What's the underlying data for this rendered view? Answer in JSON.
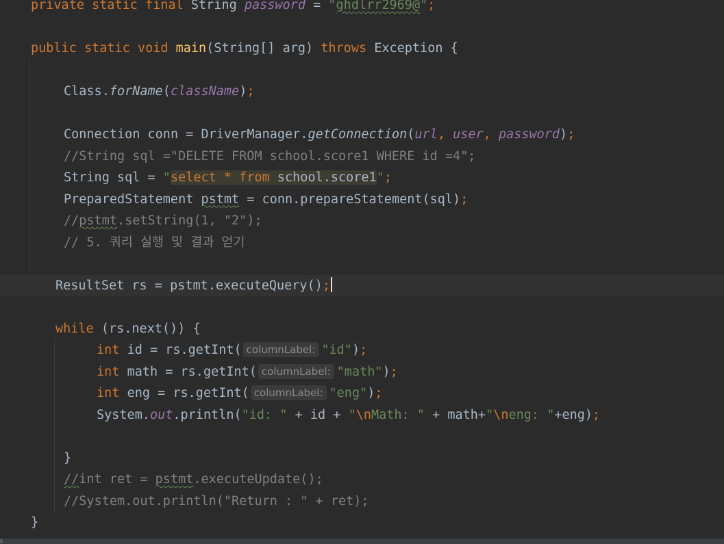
{
  "editor": {
    "language": "java",
    "current_line": 13,
    "lines": [
      {
        "indent": 45,
        "tokens": [
          {
            "t": "private static final ",
            "c": "kw"
          },
          {
            "t": "String ",
            "c": "txt"
          },
          {
            "t": "password",
            "c": "fld"
          },
          {
            "t": " = ",
            "c": "txt"
          },
          {
            "t": "\"",
            "c": "str"
          },
          {
            "t": "ghdlrr2969@",
            "c": "str",
            "w": true
          },
          {
            "t": "\"",
            "c": "str"
          },
          {
            "t": ";",
            "c": "kw"
          }
        ]
      },
      {
        "indent": 45,
        "tokens": []
      },
      {
        "indent": 45,
        "tokens": [
          {
            "t": "public static void ",
            "c": "kw"
          },
          {
            "t": "main",
            "c": "fn"
          },
          {
            "t": "(String[] arg) ",
            "c": "txt"
          },
          {
            "t": "throws ",
            "c": "kw"
          },
          {
            "t": "Exception {",
            "c": "txt"
          }
        ]
      },
      {
        "indent": 93,
        "tokens": []
      },
      {
        "indent": 93,
        "tokens": [
          {
            "t": "Class.",
            "c": "txt"
          },
          {
            "t": "forName",
            "c": "ital"
          },
          {
            "t": "(",
            "c": "txt"
          },
          {
            "t": "className",
            "c": "sfld"
          },
          {
            "t": ")",
            "c": "txt"
          },
          {
            "t": ";",
            "c": "kw"
          }
        ]
      },
      {
        "indent": 93,
        "tokens": []
      },
      {
        "indent": 93,
        "tokens": [
          {
            "t": "Connection ",
            "c": "txt"
          },
          {
            "t": "conn",
            "c": "txt"
          },
          {
            "t": " = DriverManager.",
            "c": "txt"
          },
          {
            "t": "getConnection",
            "c": "ital"
          },
          {
            "t": "(",
            "c": "txt"
          },
          {
            "t": "url",
            "c": "sfld"
          },
          {
            "t": ", ",
            "c": "kw"
          },
          {
            "t": "user",
            "c": "sfld"
          },
          {
            "t": ", ",
            "c": "kw"
          },
          {
            "t": "password",
            "c": "sfld"
          },
          {
            "t": ")",
            "c": "txt"
          },
          {
            "t": ";",
            "c": "kw"
          }
        ]
      },
      {
        "indent": 93,
        "tokens": [
          {
            "t": "//String sql =\"DELETE FROM school.score1 WHERE id =4\";",
            "c": "cmt"
          }
        ]
      },
      {
        "indent": 93,
        "tokens": [
          {
            "t": "String sql = ",
            "c": "txt"
          },
          {
            "t": "\"",
            "c": "str"
          },
          {
            "t": "select",
            "c": "sqlkw",
            "inj": true
          },
          {
            "t": " ",
            "c": "txt",
            "inj": true
          },
          {
            "t": "*",
            "c": "sqlkw",
            "inj": true
          },
          {
            "t": " ",
            "c": "txt",
            "inj": true
          },
          {
            "t": "from",
            "c": "sqlkw",
            "inj": true
          },
          {
            "t": " school.score1",
            "c": "txt",
            "inj": true
          },
          {
            "t": "\"",
            "c": "str"
          },
          {
            "t": ";",
            "c": "kw"
          }
        ]
      },
      {
        "indent": 93,
        "tokens": [
          {
            "t": "PreparedStatement ",
            "c": "txt"
          },
          {
            "t": "pstmt",
            "c": "txt",
            "w": true
          },
          {
            "t": " = conn.prepareStatement(sql)",
            "c": "txt"
          },
          {
            "t": ";",
            "c": "kw"
          }
        ]
      },
      {
        "indent": 93,
        "tokens": [
          {
            "t": "//",
            "c": "cmt"
          },
          {
            "t": "pstmt",
            "c": "cmt",
            "w": true
          },
          {
            "t": ".setString(1, \"2\");",
            "c": "cmt"
          }
        ]
      },
      {
        "indent": 93,
        "tokens": [
          {
            "t": "// 5. 쿼리 실행 및 결과 얻기",
            "c": "cmt"
          }
        ]
      },
      {
        "indent": 81,
        "tokens": []
      },
      {
        "indent": 81,
        "tokens": [
          {
            "t": "ResultSet rs = pstmt.executeQuery()",
            "c": "txt"
          },
          {
            "t": ";",
            "c": "kw"
          },
          {
            "caret": true
          }
        ]
      },
      {
        "indent": 81,
        "tokens": []
      },
      {
        "indent": 81,
        "tokens": [
          {
            "t": "while ",
            "c": "kw"
          },
          {
            "t": "(rs.next()) {",
            "c": "txt"
          }
        ]
      },
      {
        "indent": 141,
        "tokens": [
          {
            "t": "int ",
            "c": "kw"
          },
          {
            "t": "id = rs.getInt(",
            "c": "txt"
          },
          {
            "hint": "columnLabel:"
          },
          {
            "t": "\"id\"",
            "c": "str"
          },
          {
            "t": ")",
            "c": "txt"
          },
          {
            "t": ";",
            "c": "kw"
          }
        ]
      },
      {
        "indent": 141,
        "tokens": [
          {
            "t": "int ",
            "c": "kw"
          },
          {
            "t": "math = rs.getInt(",
            "c": "txt"
          },
          {
            "hint": "columnLabel:"
          },
          {
            "t": "\"math\"",
            "c": "str"
          },
          {
            "t": ")",
            "c": "txt"
          },
          {
            "t": ";",
            "c": "kw"
          }
        ]
      },
      {
        "indent": 141,
        "tokens": [
          {
            "t": "int ",
            "c": "kw"
          },
          {
            "t": "eng = rs.getInt(",
            "c": "txt"
          },
          {
            "hint": "columnLabel:"
          },
          {
            "t": "\"eng\"",
            "c": "str"
          },
          {
            "t": ")",
            "c": "txt"
          },
          {
            "t": ";",
            "c": "kw"
          }
        ]
      },
      {
        "indent": 141,
        "tokens": [
          {
            "t": "System.",
            "c": "txt"
          },
          {
            "t": "out",
            "c": "sfld"
          },
          {
            "t": ".println(",
            "c": "txt"
          },
          {
            "t": "\"id: \"",
            "c": "str"
          },
          {
            "t": " + id + ",
            "c": "txt"
          },
          {
            "t": "\"",
            "c": "str"
          },
          {
            "t": "\\n",
            "c": "esc"
          },
          {
            "t": "Math: \"",
            "c": "str"
          },
          {
            "t": " + math+",
            "c": "txt"
          },
          {
            "t": "\"",
            "c": "str"
          },
          {
            "t": "\\n",
            "c": "esc"
          },
          {
            "t": "eng: \"",
            "c": "str"
          },
          {
            "t": "+eng)",
            "c": "txt"
          },
          {
            "t": ";",
            "c": "kw"
          }
        ]
      },
      {
        "indent": 93,
        "tokens": []
      },
      {
        "indent": 93,
        "tokens": [
          {
            "t": "}",
            "c": "txt"
          }
        ]
      },
      {
        "indent": 93,
        "tokens": [
          {
            "t": "//",
            "c": "cmt",
            "w": true
          },
          {
            "t": "int ret = ",
            "c": "cmt"
          },
          {
            "t": "pstmt",
            "c": "cmt",
            "w": true
          },
          {
            "t": ".executeUpdate();",
            "c": "cmt"
          }
        ]
      },
      {
        "indent": 93,
        "tokens": [
          {
            "t": "//System.out.println(\"Return : \" + ret);",
            "c": "cmt"
          }
        ]
      },
      {
        "indent": 45,
        "tokens": [
          {
            "t": "}",
            "c": "txt"
          }
        ]
      }
    ]
  }
}
